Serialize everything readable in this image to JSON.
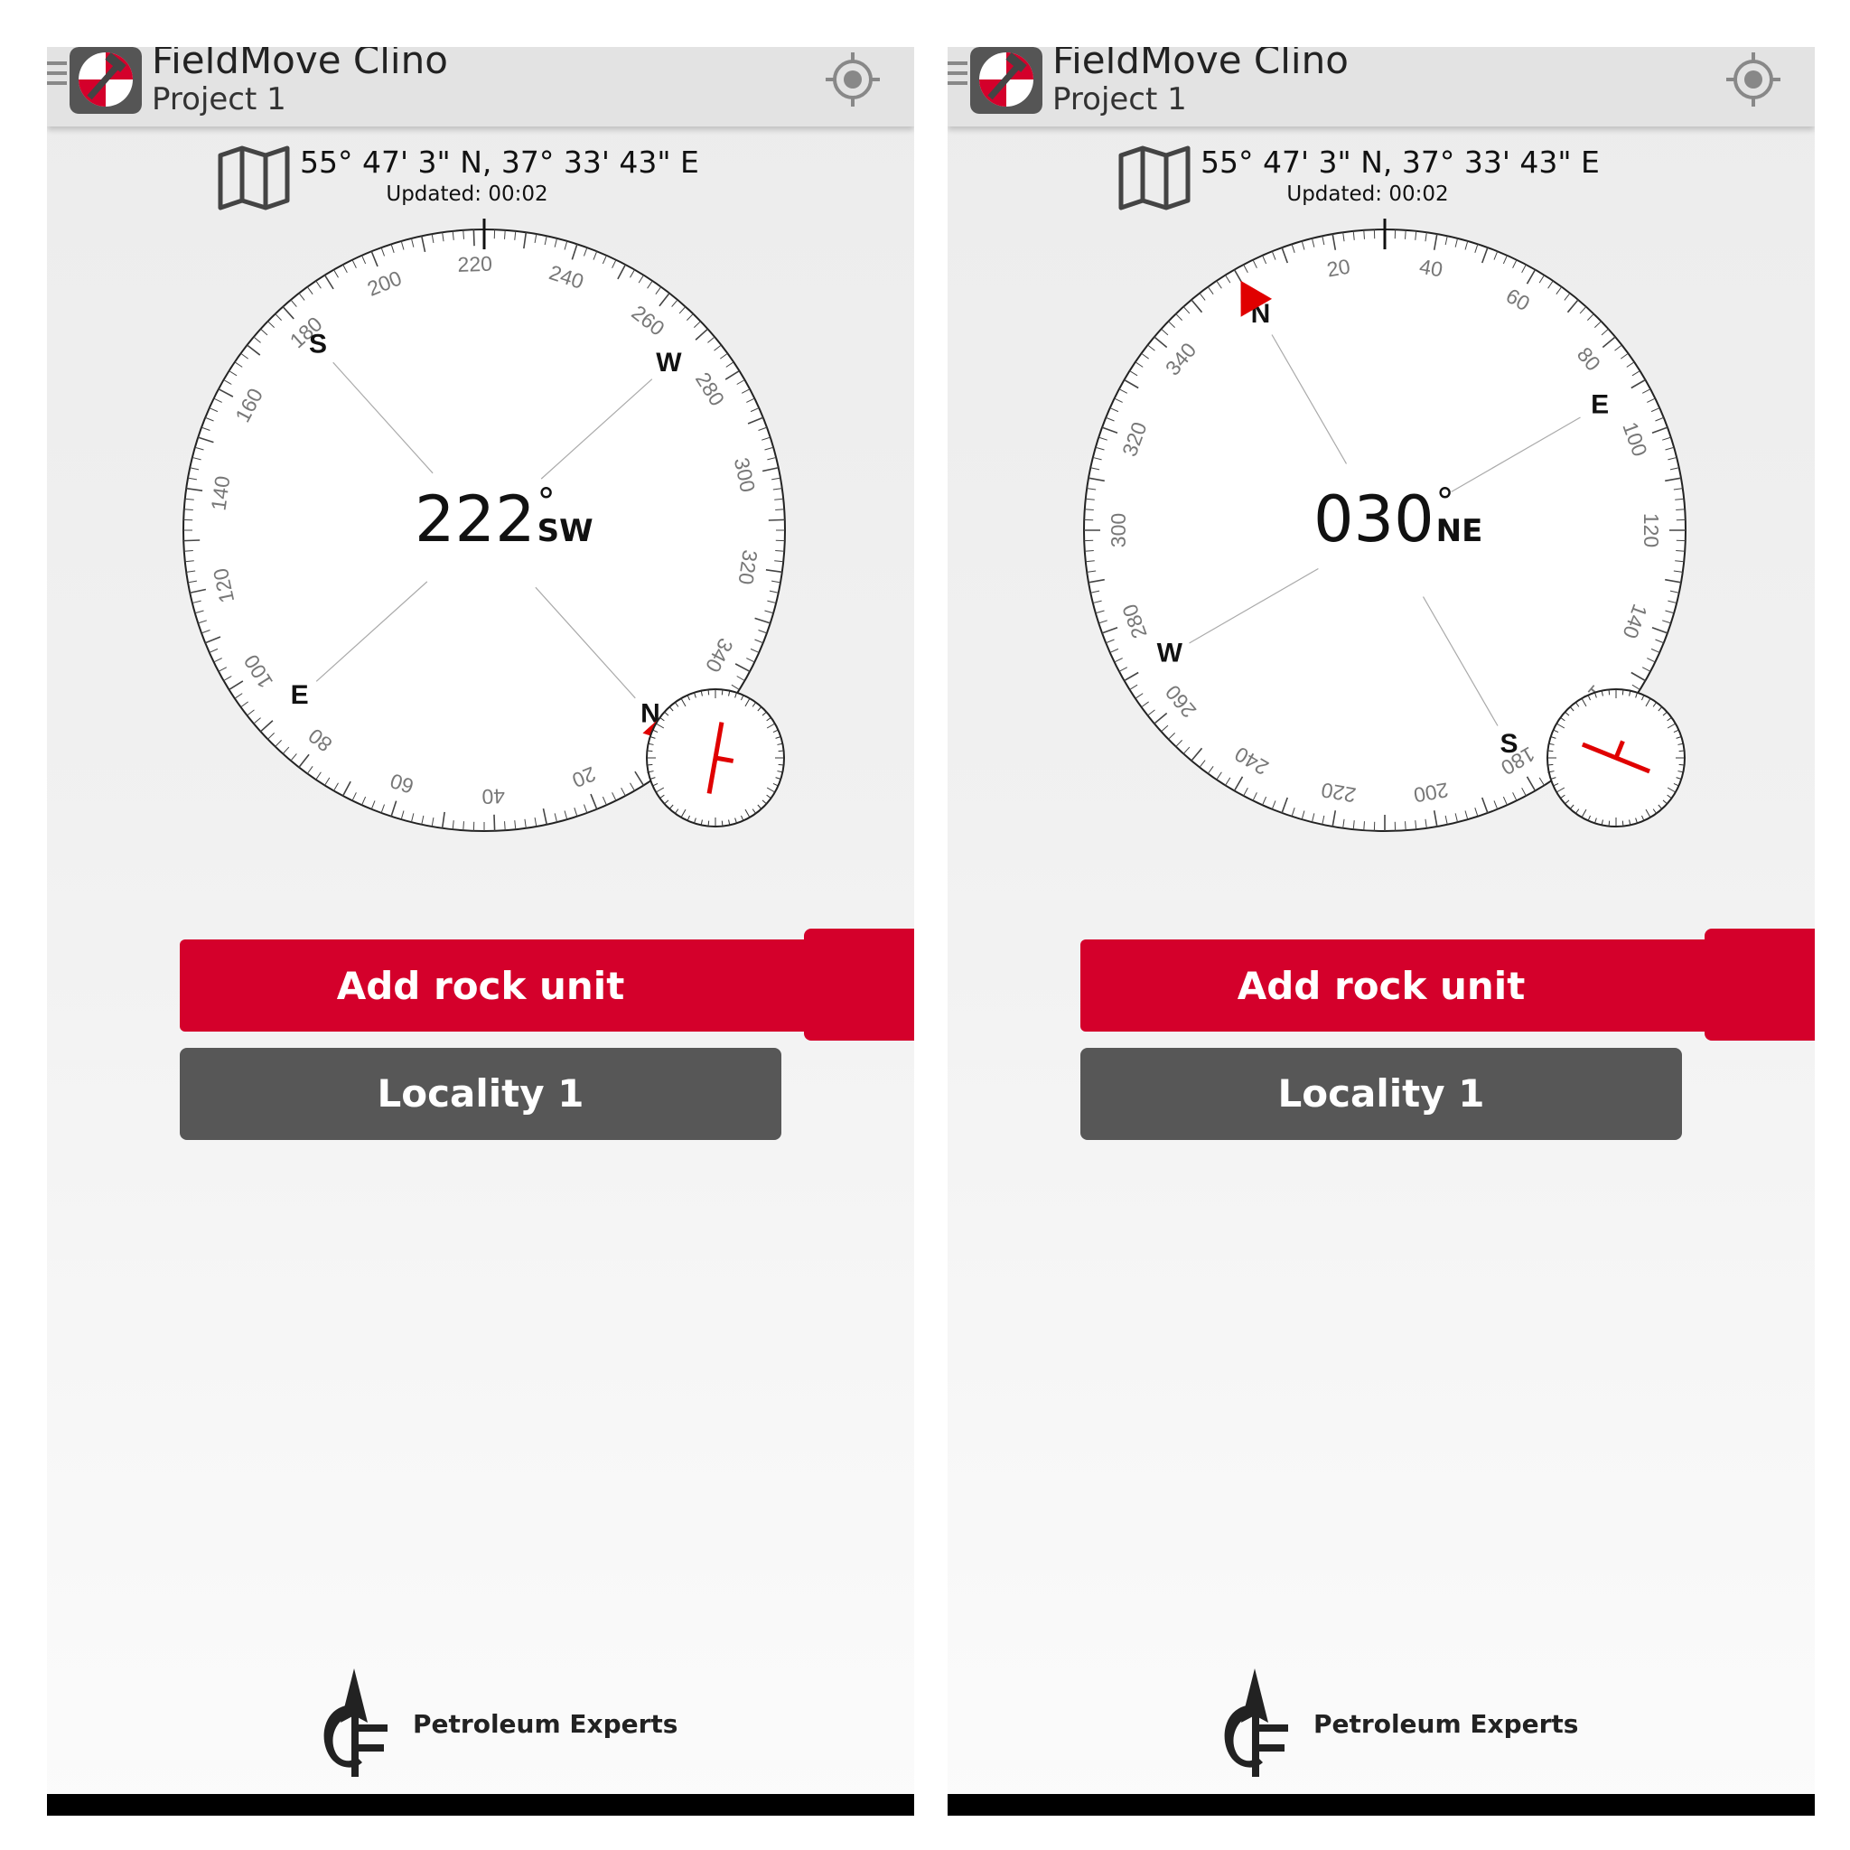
{
  "screens": [
    {
      "app_title": "FieldMove Clino",
      "project": "Project 1",
      "coordinates": "55° 47' 3\" N, 37° 33' 43\" E",
      "updated": "Updated: 00:02",
      "heading": {
        "value": "222",
        "degree_symbol": "°",
        "direction": "SW",
        "degrees": 222
      },
      "add_rock_unit_label": "Add rock unit",
      "locality_label": "Locality 1",
      "brand_name": "Petroleum Experts"
    },
    {
      "app_title": "FieldMove Clino",
      "project": "Project 1",
      "coordinates": "55° 47' 3\" N, 37° 33' 43\" E",
      "updated": "Updated: 00:02",
      "heading": {
        "value": "030",
        "degree_symbol": "°",
        "direction": "NE",
        "degrees": 30
      },
      "add_rock_unit_label": "Add rock unit",
      "locality_label": "Locality 1",
      "brand_name": "Petroleum Experts"
    }
  ],
  "colors": {
    "accent_red": "#d4002b",
    "button_gray": "#575757",
    "header_bg": "#e3e3e3"
  },
  "icons": [
    "menu-icon",
    "app-logo-icon",
    "gps-locate-icon",
    "map-icon",
    "clinometer-icon",
    "petroleum-experts-logo"
  ]
}
